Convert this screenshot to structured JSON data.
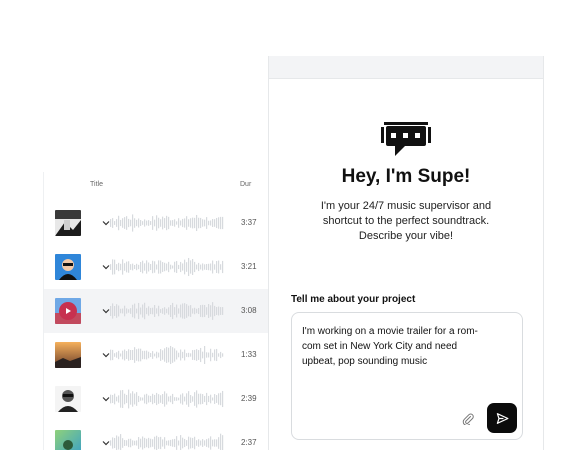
{
  "track_list": {
    "header": {
      "title": "Title",
      "dur": "Dur"
    },
    "rows": [
      {
        "duration": "3:37",
        "active": false
      },
      {
        "duration": "3:21",
        "active": false
      },
      {
        "duration": "3:08",
        "active": true
      },
      {
        "duration": "1:33",
        "active": false
      },
      {
        "duration": "2:39",
        "active": false
      },
      {
        "duration": "2:37",
        "active": false
      }
    ]
  },
  "chat": {
    "logo_icon": "chat-bubble-robot-icon",
    "greeting": "Hey, I'm Supe!",
    "intro_lines": [
      "I'm your 24/7 music supervisor and",
      "shortcut to the perfect soundtrack.",
      "Describe your vibe!"
    ],
    "prompt_label": "Tell me about your project",
    "input_lines": [
      "I'm working on a movie trailer for a rom-",
      "com set in New York City and need",
      "upbeat, pop sounding music"
    ],
    "attach_icon": "paperclip-icon",
    "send_icon": "send-icon"
  },
  "colors": {
    "accent": "#c7314f",
    "send_button": "#0b0b0b",
    "panel_top": "#f3f4f6"
  }
}
